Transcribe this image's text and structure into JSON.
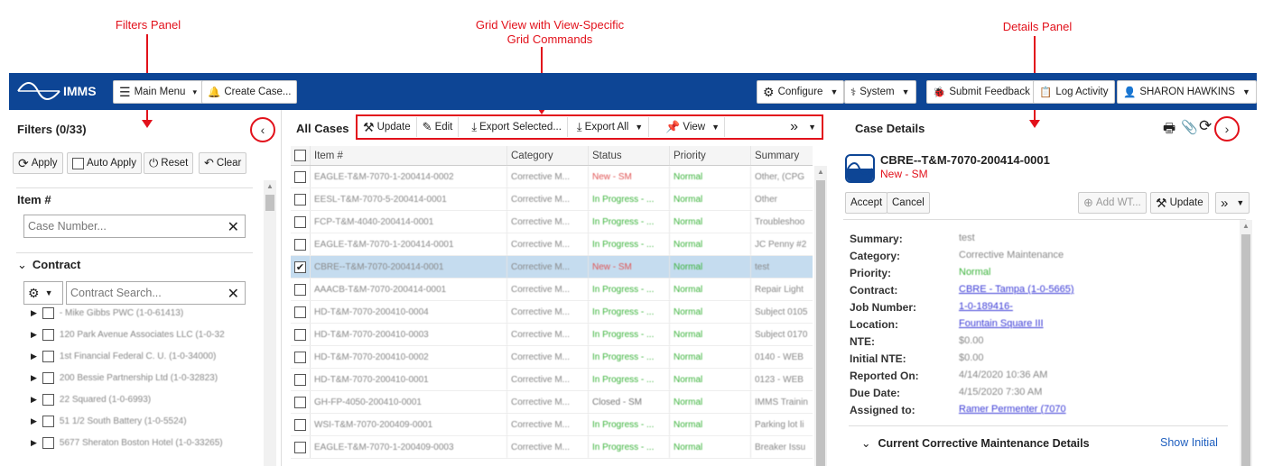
{
  "annotations": {
    "filters_panel": "Filters Panel",
    "grid_view_line1": "Grid View with View-Specific",
    "grid_view_line2": "Grid Commands",
    "details_panel": "Details Panel"
  },
  "topbar": {
    "brand": "IMMS",
    "main_menu": "Main Menu",
    "create_case": "Create Case...",
    "configure": "Configure",
    "system": "System",
    "submit_feedback": "Submit Feedback",
    "log_activity": "Log Activity",
    "user": "SHARON HAWKINS"
  },
  "filters": {
    "title": "Filters (0/33)",
    "apply": "Apply",
    "auto_apply": "Auto Apply",
    "reset": "Reset",
    "clear": "Clear",
    "item_label": "Item #",
    "case_placeholder": "Case Number...",
    "contract_label": "Contract",
    "contract_placeholder": "Contract Search...",
    "contracts": [
      "- Mike Gibbs PWC (1-0-61413)",
      "120 Park Avenue Associates LLC (1-0-32",
      "1st Financial Federal C. U. (1-0-34000)",
      "200 Bessie Partnership Ltd (1-0-32823)",
      "22 Squared (1-0-6993)",
      "51 1/2 South Battery (1-0-5524)",
      "5677 Sheraton Boston Hotel (1-0-33265)"
    ]
  },
  "grid": {
    "title": "All Cases",
    "commands": {
      "update": "Update",
      "edit": "Edit",
      "export_selected": "Export Selected...",
      "export_all": "Export All",
      "view": "View",
      "more": "»"
    },
    "columns": [
      "Item #",
      "Category",
      "Status",
      "Priority",
      "Summary"
    ],
    "rows": [
      {
        "item": "EAGLE-T&M-7070-1-200414-0002",
        "category": "Corrective M...",
        "status": "New - SM",
        "priority": "Normal",
        "summary": "Other, (CPG",
        "checked": false
      },
      {
        "item": "EESL-T&M-7070-5-200414-0001",
        "category": "Corrective M...",
        "status": "In Progress - ...",
        "priority": "Normal",
        "summary": "Other",
        "checked": false
      },
      {
        "item": "FCP-T&M-4040-200414-0001",
        "category": "Corrective M...",
        "status": "In Progress - ...",
        "priority": "Normal",
        "summary": "Troubleshoo",
        "checked": false
      },
      {
        "item": "EAGLE-T&M-7070-1-200414-0001",
        "category": "Corrective M...",
        "status": "In Progress - ...",
        "priority": "Normal",
        "summary": "JC Penny #2",
        "checked": false
      },
      {
        "item": "CBRE--T&M-7070-200414-0001",
        "category": "Corrective M...",
        "status": "New - SM",
        "priority": "Normal",
        "summary": "test",
        "checked": true
      },
      {
        "item": "AAACB-T&M-7070-200414-0001",
        "category": "Corrective M...",
        "status": "In Progress - ...",
        "priority": "Normal",
        "summary": "Repair Light",
        "checked": false
      },
      {
        "item": "HD-T&M-7070-200410-0004",
        "category": "Corrective M...",
        "status": "In Progress - ...",
        "priority": "Normal",
        "summary": "Subject 0105",
        "checked": false
      },
      {
        "item": "HD-T&M-7070-200410-0003",
        "category": "Corrective M...",
        "status": "In Progress - ...",
        "priority": "Normal",
        "summary": "Subject 0170",
        "checked": false
      },
      {
        "item": "HD-T&M-7070-200410-0002",
        "category": "Corrective M...",
        "status": "In Progress - ...",
        "priority": "Normal",
        "summary": "0140 - WEB",
        "checked": false
      },
      {
        "item": "HD-T&M-7070-200410-0001",
        "category": "Corrective M...",
        "status": "In Progress - ...",
        "priority": "Normal",
        "summary": "0123 - WEB",
        "checked": false
      },
      {
        "item": "GH-FP-4050-200410-0001",
        "category": "Corrective M...",
        "status": "Closed - SM",
        "priority": "Normal",
        "summary": "IMMS Trainin",
        "checked": false
      },
      {
        "item": "WSI-T&M-7070-200409-0001",
        "category": "Corrective M...",
        "status": "In Progress - ...",
        "priority": "Normal",
        "summary": "Parking lot li",
        "checked": false
      },
      {
        "item": "EAGLE-T&M-7070-1-200409-0003",
        "category": "Corrective M...",
        "status": "In Progress - ...",
        "priority": "Normal",
        "summary": "Breaker Issu",
        "checked": false
      }
    ]
  },
  "details": {
    "title": "Case Details",
    "case_id": "CBRE--T&M-7070-200414-0001",
    "case_status": "New - SM",
    "accept": "Accept",
    "cancel": "Cancel",
    "add_wt": "Add WT...",
    "update": "Update",
    "more": "»",
    "fields": [
      {
        "label": "Summary:",
        "value": "test",
        "style": "plain"
      },
      {
        "label": "Category:",
        "value": "Corrective Maintenance",
        "style": "plain"
      },
      {
        "label": "Priority:",
        "value": "Normal",
        "style": "green"
      },
      {
        "label": "Contract:",
        "value": "CBRE - Tampa (1-0-5665)",
        "style": "link"
      },
      {
        "label": "Job Number:",
        "value": "1-0-189416-",
        "style": "link"
      },
      {
        "label": "Location:",
        "value": "Fountain Square III",
        "style": "link"
      },
      {
        "label": "NTE:",
        "value": "$0.00",
        "style": "plain"
      },
      {
        "label": "Initial NTE:",
        "value": "$0.00",
        "style": "plain"
      },
      {
        "label": "Reported On:",
        "value": "4/14/2020 10:36 AM",
        "style": "plain"
      },
      {
        "label": "Due Date:",
        "value": "4/15/2020 7:30 AM",
        "style": "plain"
      },
      {
        "label": "Assigned to:",
        "value": "Ramer Permenter (7070",
        "style": "link"
      }
    ],
    "section_title": "Current Corrective Maintenance Details",
    "show_initial": "Show Initial"
  }
}
